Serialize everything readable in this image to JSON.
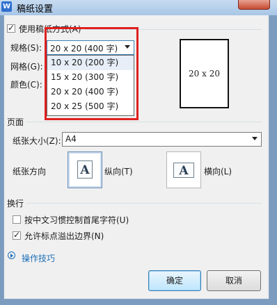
{
  "window": {
    "title": "稿纸设置",
    "app_icon": "W"
  },
  "use_style": {
    "label": "使用稿纸方式(A)",
    "checked": true
  },
  "spec": {
    "label": "规格(S):",
    "selected": "20 x 20 (400 字)",
    "options": [
      "10 x 20 (200 字)",
      "15 x 20 (300 字)",
      "20 x 20 (400 字)",
      "20 x 25 (500 字)"
    ]
  },
  "grid": {
    "label": "网格(G):"
  },
  "color": {
    "label": "颜色(C):"
  },
  "preview": {
    "text": "20 x 20"
  },
  "page_section": {
    "title": "页面",
    "paper_size_label": "纸张大小(Z):",
    "paper_size_value": "A4",
    "orientation_label": "纸张方向",
    "portrait_label": "纵向(T)",
    "landscape_label": "横向(L)",
    "icon_letter": "A"
  },
  "wrap_section": {
    "title": "换行",
    "option1": {
      "label": "按中文习惯控制首尾字符(U)",
      "checked": false
    },
    "option2": {
      "label": "允许标点溢出边界(N)",
      "checked": true
    }
  },
  "tips": {
    "label": "操作技巧",
    "color": "#1d6fb8"
  },
  "buttons": {
    "ok": "确定",
    "cancel": "取消"
  },
  "annotation_color": "#e02020"
}
